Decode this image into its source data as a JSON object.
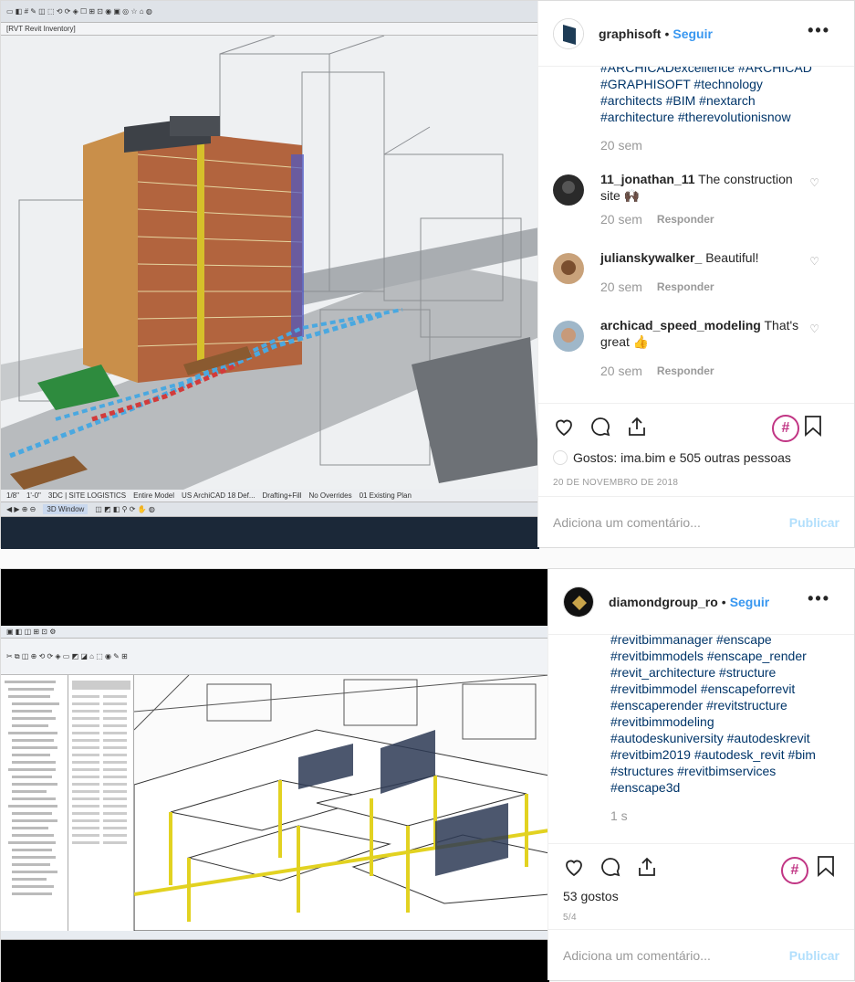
{
  "post1": {
    "username": "graphisoft",
    "follow_label": "Seguir",
    "more_label": "•••",
    "caption_hashtags": "#ARCHICADexcellence #ARCHICAD #GRAPHISOFT #technology #architects #BIM #nextarch #architecture #therevolutionisnow",
    "caption_time": "20 sem",
    "comments": [
      {
        "user": "11_jonathan_11",
        "text": "The construction site 🙌🏿",
        "time": "20 sem",
        "reply": "Responder"
      },
      {
        "user": "julianskywalker_",
        "text": "Beautiful!",
        "time": "20 sem",
        "reply": "Responder"
      },
      {
        "user": "archicad_speed_modeling",
        "text": "That's great 👍",
        "time": "20 sem",
        "reply": "Responder"
      }
    ],
    "likes_text": "Gostos: ima.bim e 505 outras pessoas",
    "date": "20 DE NOVEMBRO DE 2018",
    "comment_placeholder": "Adiciona um comentário...",
    "publish_label": "Publicar",
    "hash_badge": "#",
    "screen": {
      "tab_label": "[RVT Revit Inventory]",
      "status_items": [
        "1/8\"",
        "1'-0\"",
        "3DC | SITE LOGISTICS",
        "Entire Model",
        "US ArchiCAD 18 Def...",
        "Drafting+Fill",
        "No Overrides",
        "01 Existing Plan"
      ],
      "window_label": "3D Window"
    }
  },
  "post2": {
    "username": "diamondgroup_ro",
    "follow_label": "Seguir",
    "more_label": "•••",
    "caption_hashtags": "#revitbimmanager #enscape #revitbimmodels #enscape_render #revit_architecture #structure #revitbimmodel #enscapeforrevit #enscaperender #revitstructure #revitbimmodeling #autodeskuniversity #autodeskrevit #revitbim2019 #autodesk_revit #bim #structures #revitbimservices #enscape3d",
    "caption_time": "1 s",
    "likes_text": "53 gostos",
    "date": "5/4",
    "comment_placeholder": "Adiciona um comentário...",
    "publish_label": "Publicar",
    "hash_badge": "#"
  }
}
